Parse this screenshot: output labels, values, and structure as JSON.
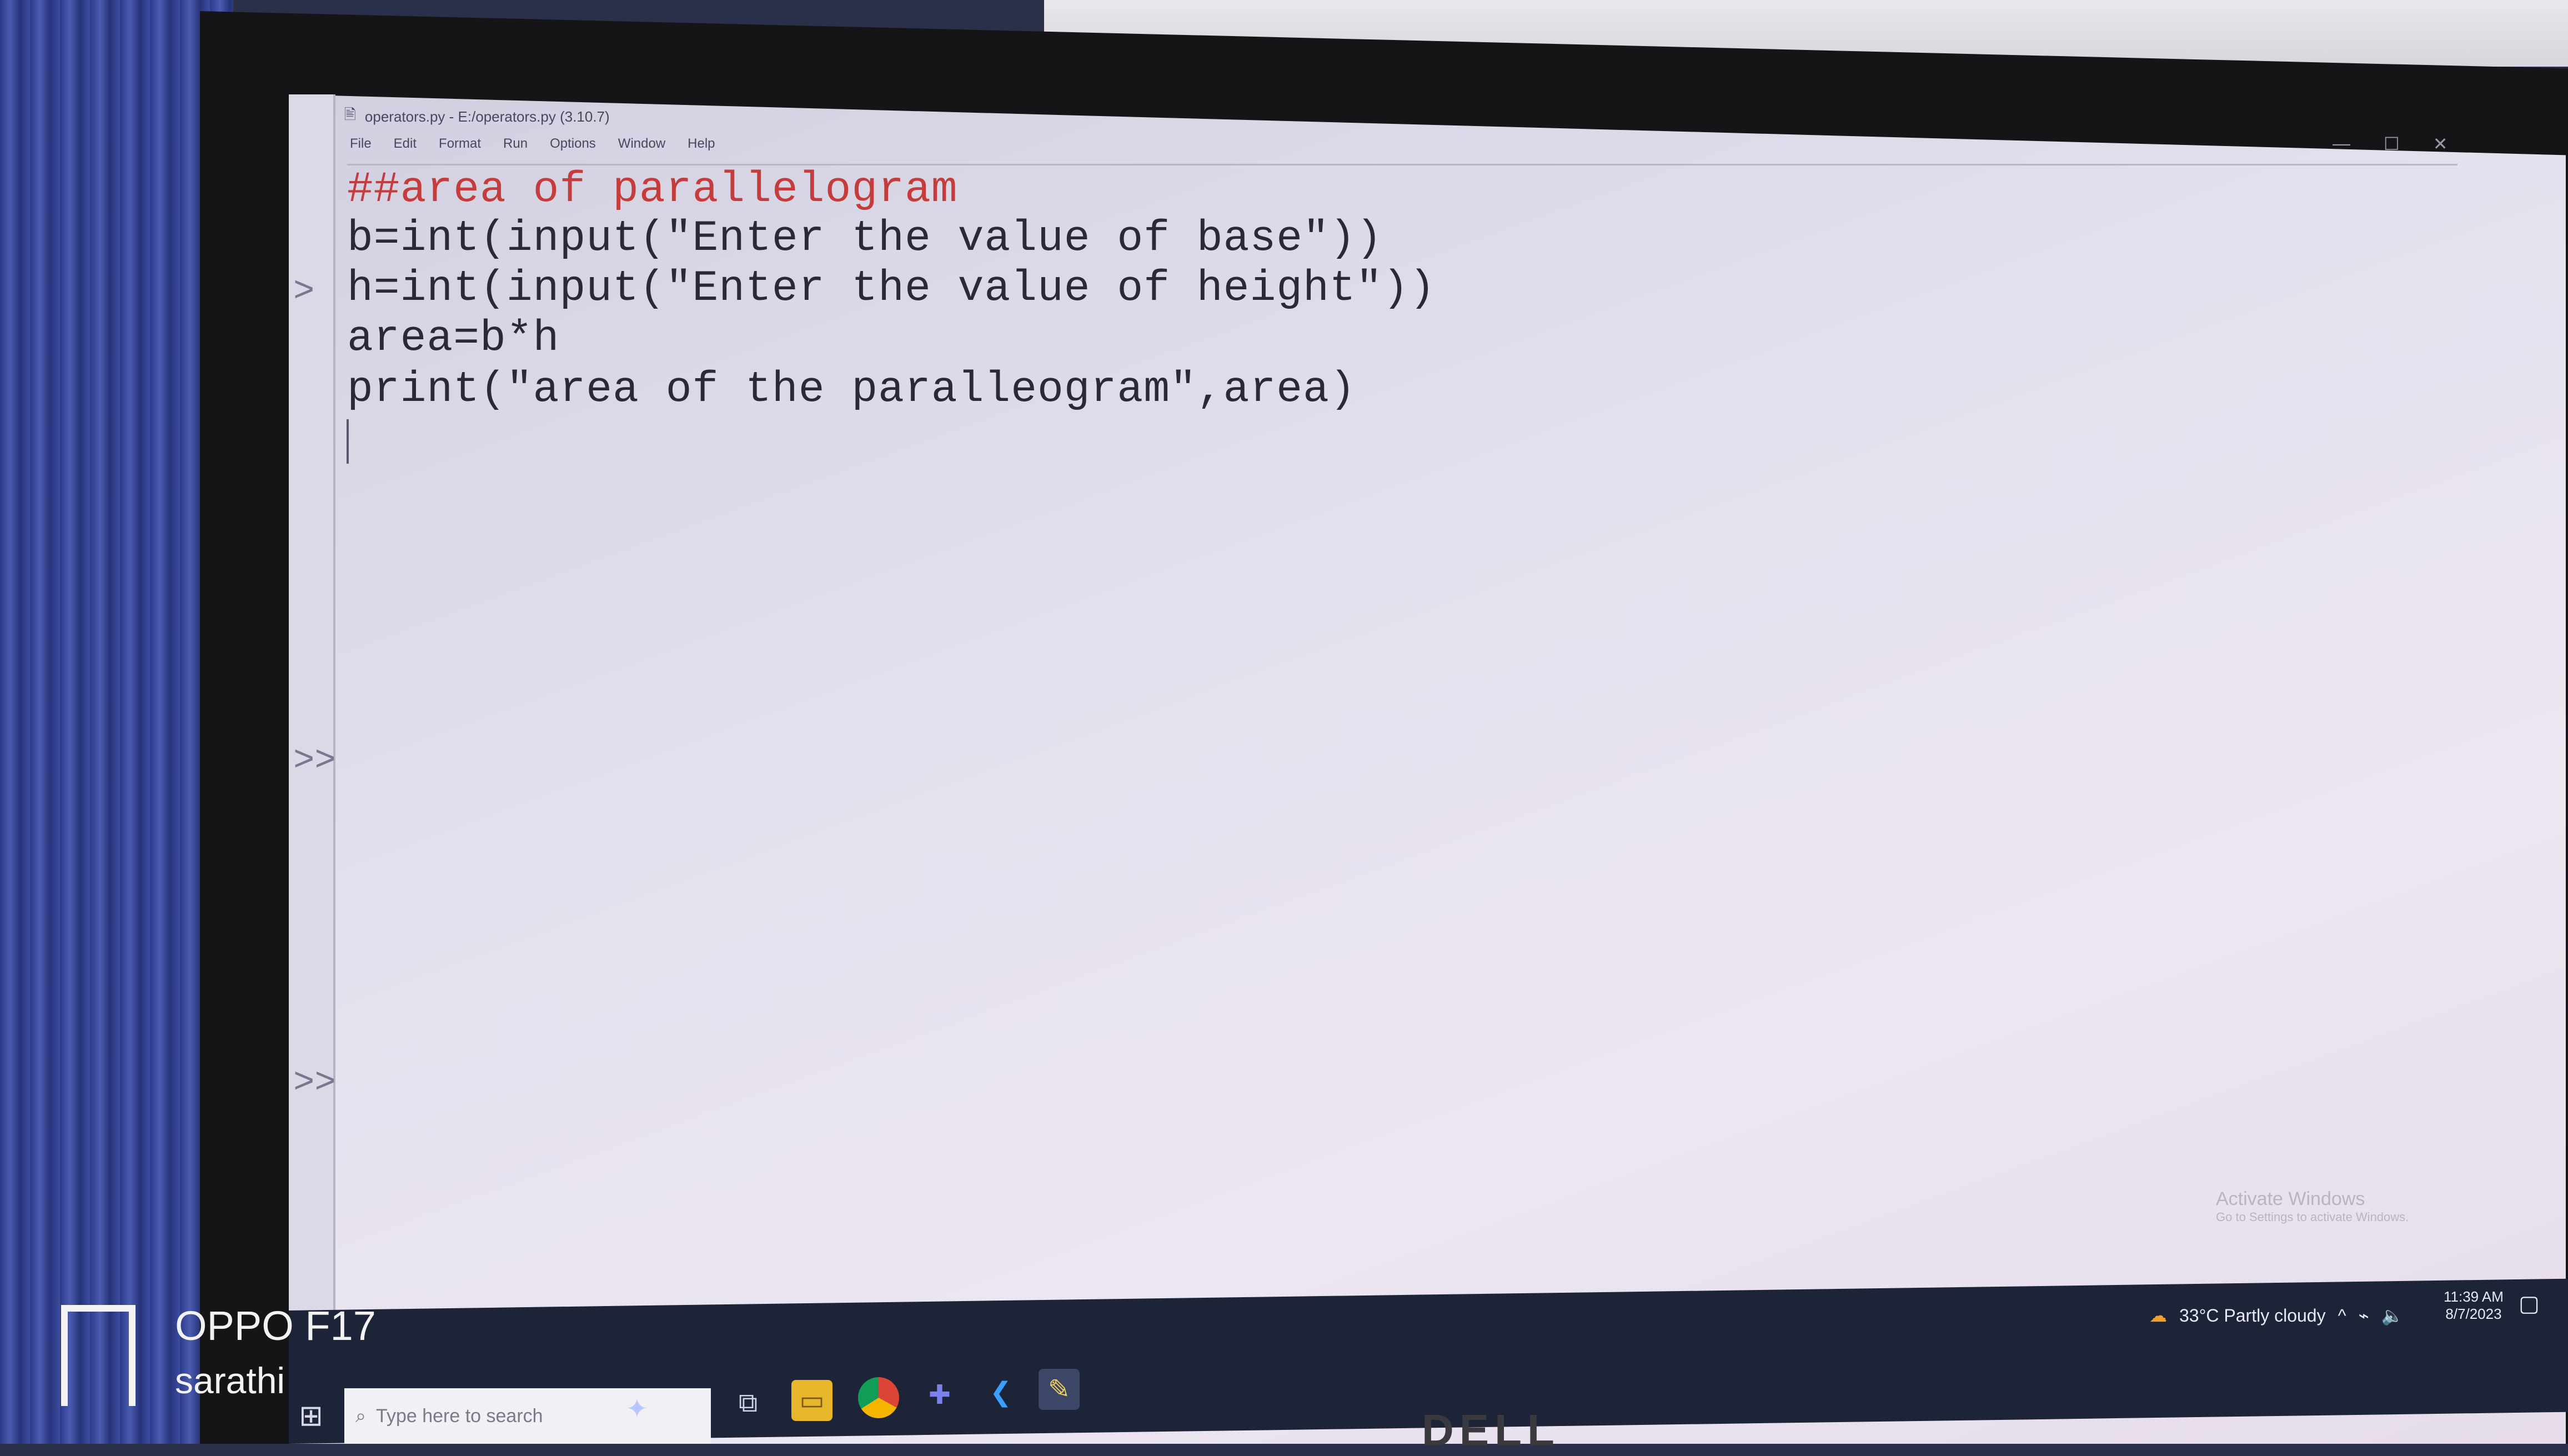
{
  "window": {
    "title": "operators.py - E:/operators.py (3.10.7)",
    "controls": [
      "—",
      "☐",
      "✕"
    ]
  },
  "menu": [
    "File",
    "Edit",
    "Format",
    "Run",
    "Options",
    "Window",
    "Help"
  ],
  "shell": {
    "prompts": [
      ">",
      ">>",
      ">>"
    ]
  },
  "code": {
    "lines": [
      "##area of parallelogram",
      "b=int(input(\"Enter the value of base\"))",
      "h=int(input(\"Enter the value of height\"))",
      "area=b*h",
      "print(\"area of the paralleogram\",area)"
    ]
  },
  "watermark": {
    "line1": "Activate Windows",
    "line2": "Go to Settings to activate Windows."
  },
  "taskbar": {
    "search_placeholder": "Type here to search",
    "weather": "33°C  Partly cloudy",
    "time": "11:39 AM",
    "date": "8/7/2023"
  },
  "monitor": {
    "brand": "DELL"
  },
  "camera": {
    "model": "OPPO F17",
    "user": "sarathi"
  },
  "colors": {
    "comment": "#c43c3c",
    "taskbar": "#1d2437",
    "screen": "#e4e1ee"
  }
}
